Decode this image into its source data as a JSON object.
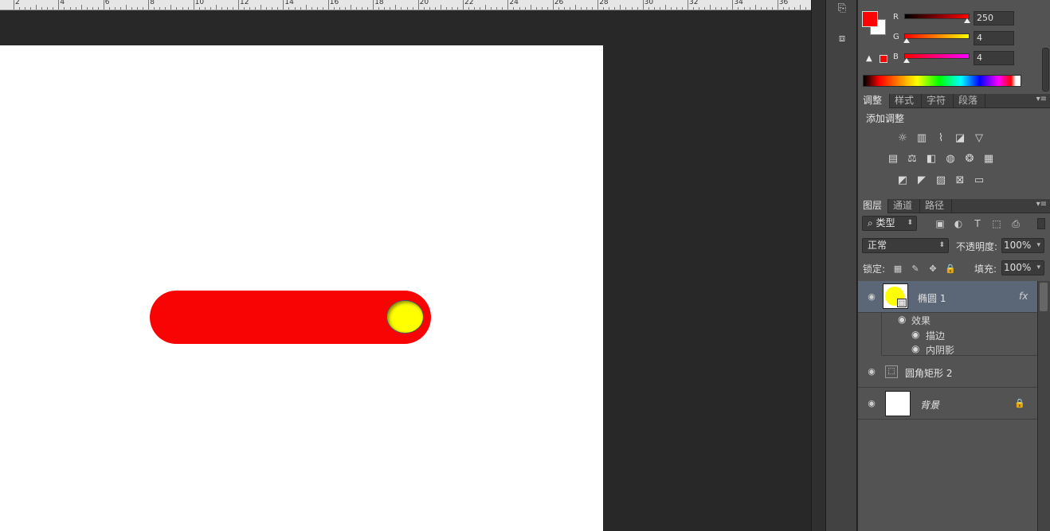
{
  "ruler": {
    "labels": [
      "2",
      "4",
      "6",
      "8",
      "10",
      "12",
      "14",
      "16",
      "18",
      "20",
      "22",
      "24",
      "26",
      "28",
      "30",
      "32",
      "34",
      "36"
    ]
  },
  "canvas": {
    "track_color": "#f90404",
    "knob_color": "#ffff00"
  },
  "minibar": {
    "icons": [
      "history-icon",
      "3d-icon"
    ]
  },
  "color_panel": {
    "foreground_color": "#fa0404",
    "r_label": "R",
    "g_label": "G",
    "b_label": "B",
    "r_value": "250",
    "g_value": "4",
    "b_value": "4",
    "warning_icon": "gamut-warning-icon"
  },
  "adjust_panel": {
    "tabs": [
      "调整",
      "样式",
      "字符",
      "段落"
    ],
    "title": "添加调整",
    "icons_row1": [
      "brightness-icon",
      "levels-icon",
      "curves-icon",
      "exposure-icon",
      "vibrance-icon"
    ],
    "icons_row2": [
      "hue-icon",
      "color-balance-icon",
      "bw-icon",
      "photo-filter-icon",
      "channel-mixer-icon",
      "color-lookup-icon"
    ],
    "icons_row3": [
      "invert-icon",
      "posterize-icon",
      "threshold-icon",
      "selective-color-icon",
      "gradient-map-icon"
    ]
  },
  "layers_panel": {
    "tabs": [
      "图层",
      "通道",
      "路径"
    ],
    "filter_label": "类型",
    "blend_mode": "正常",
    "opacity_label": "不透明度:",
    "opacity_value": "100%",
    "lock_label": "锁定:",
    "fill_label": "填充:",
    "fill_value": "100%",
    "layers": [
      {
        "name": "椭圆 1",
        "fx": "fx"
      },
      {
        "name": "圆角矩形 2"
      },
      {
        "name": "背景"
      }
    ],
    "effects_label": "效果",
    "effect_items": [
      "描边",
      "内阴影"
    ]
  }
}
